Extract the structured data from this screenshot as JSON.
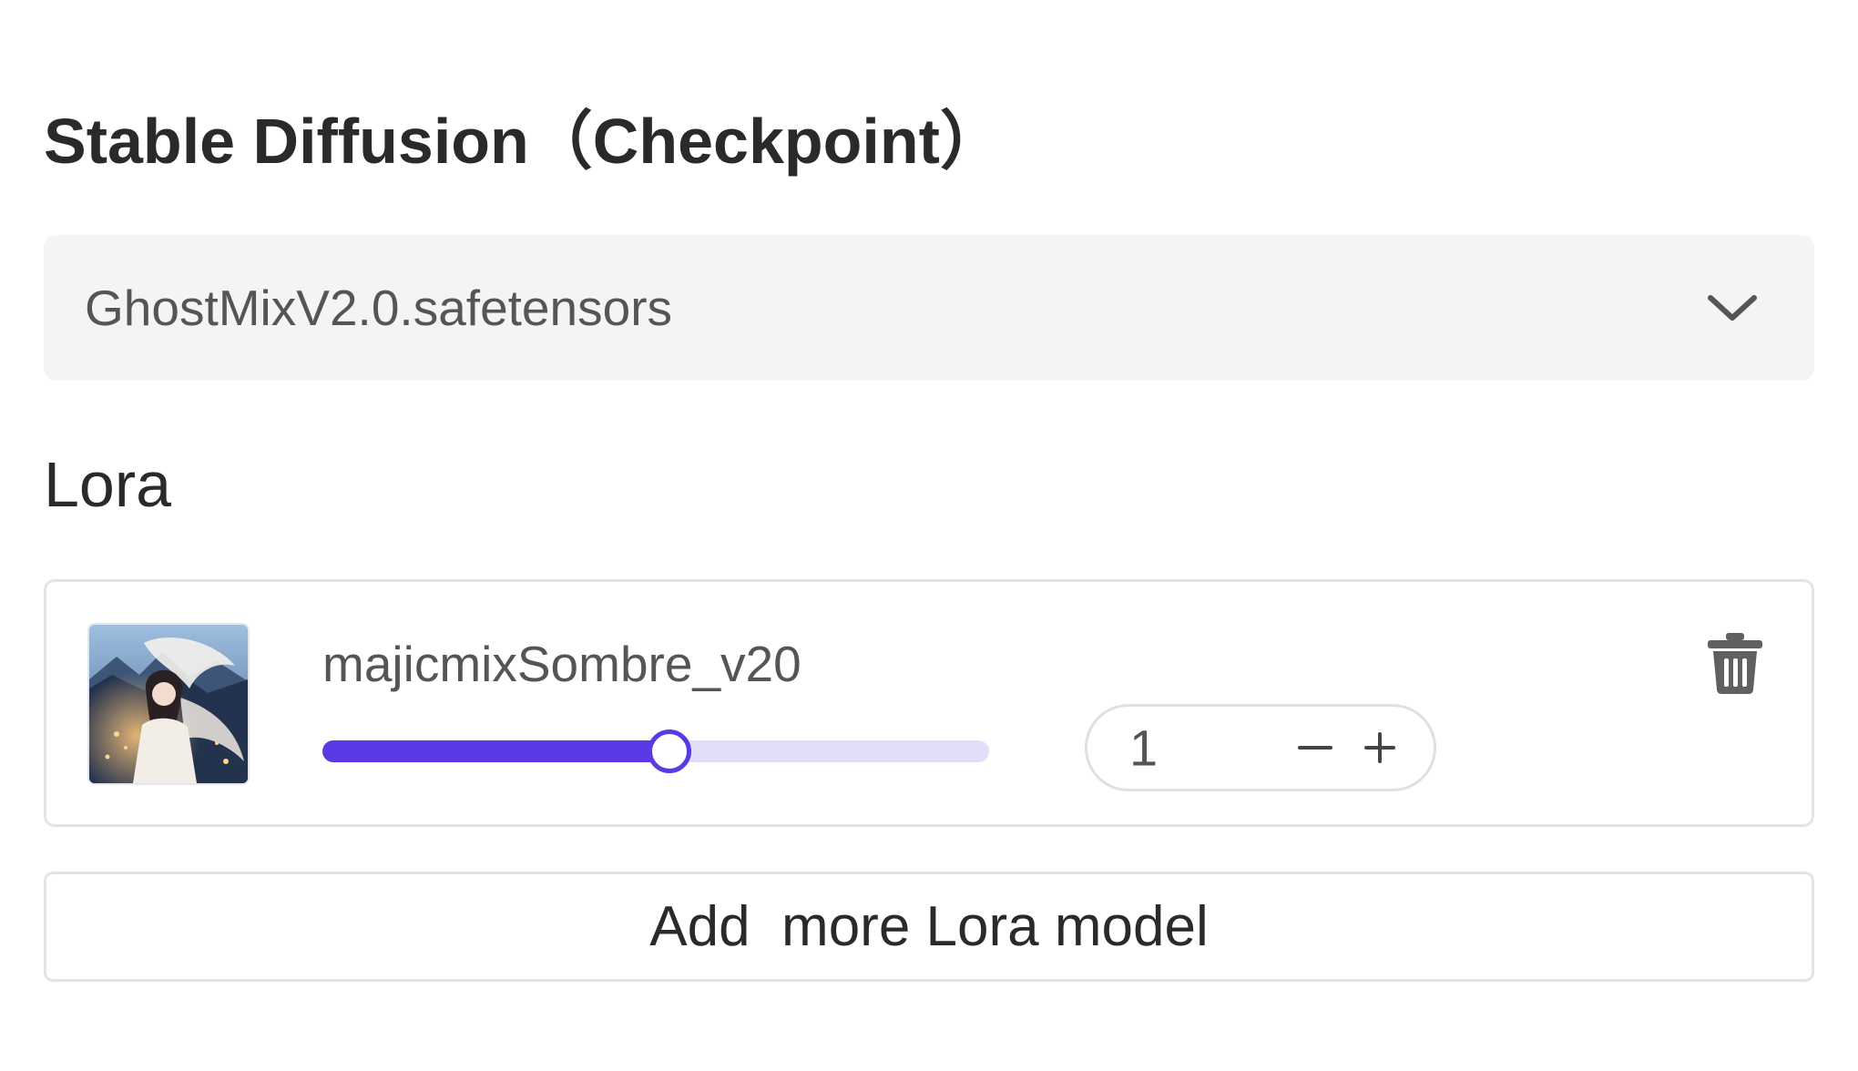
{
  "checkpoint": {
    "title": "Stable Diffusion（Checkpoint）",
    "selected_model": "GhostMixV2.0.safetensors",
    "dropdown_icon": "chevron-down-icon"
  },
  "lora": {
    "title": "Lora",
    "items": [
      {
        "name": "majicmixSombre_v20",
        "thumbnail_icon": "lora-thumbnail",
        "weight_slider_fraction": 0.52,
        "weight_value": "1",
        "delete_icon": "trash-icon"
      }
    ],
    "add_button_label": "Add  more Lora model"
  },
  "colors": {
    "accent": "#5b3ae6",
    "track": "#e2defa",
    "select_bg": "#f4f4f4",
    "border": "#e4e4e4"
  }
}
